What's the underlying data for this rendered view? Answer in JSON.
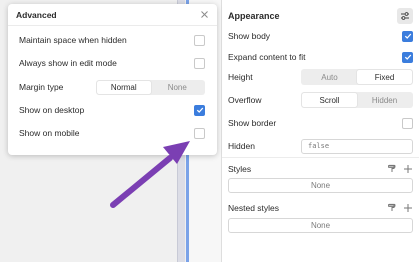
{
  "advanced": {
    "title": "Advanced",
    "maintain_space_label": "Maintain space when hidden",
    "maintain_space_checked": false,
    "always_show_label": "Always show in edit mode",
    "always_show_checked": false,
    "margin_type_label": "Margin type",
    "margin_options": [
      "Normal",
      "None"
    ],
    "margin_selected": "Normal",
    "show_desktop_label": "Show on desktop",
    "show_desktop_checked": true,
    "show_mobile_label": "Show on mobile",
    "show_mobile_checked": false
  },
  "appearance": {
    "title": "Appearance",
    "show_body_label": "Show body",
    "show_body_checked": true,
    "expand_label": "Expand content to fit",
    "expand_checked": true,
    "height_label": "Height",
    "height_options": [
      "Auto",
      "Fixed"
    ],
    "height_selected": "Fixed",
    "overflow_label": "Overflow",
    "overflow_options": [
      "Scroll",
      "Hidden"
    ],
    "overflow_selected": "Scroll",
    "show_border_label": "Show border",
    "show_border_checked": false,
    "hidden_label": "Hidden",
    "hidden_value": "false"
  },
  "styles": {
    "title": "Styles",
    "value": "None"
  },
  "nested_styles": {
    "title": "Nested styles",
    "value": "None"
  },
  "colors": {
    "accent": "#3b7ddd",
    "arrow": "#7b3fb3"
  }
}
